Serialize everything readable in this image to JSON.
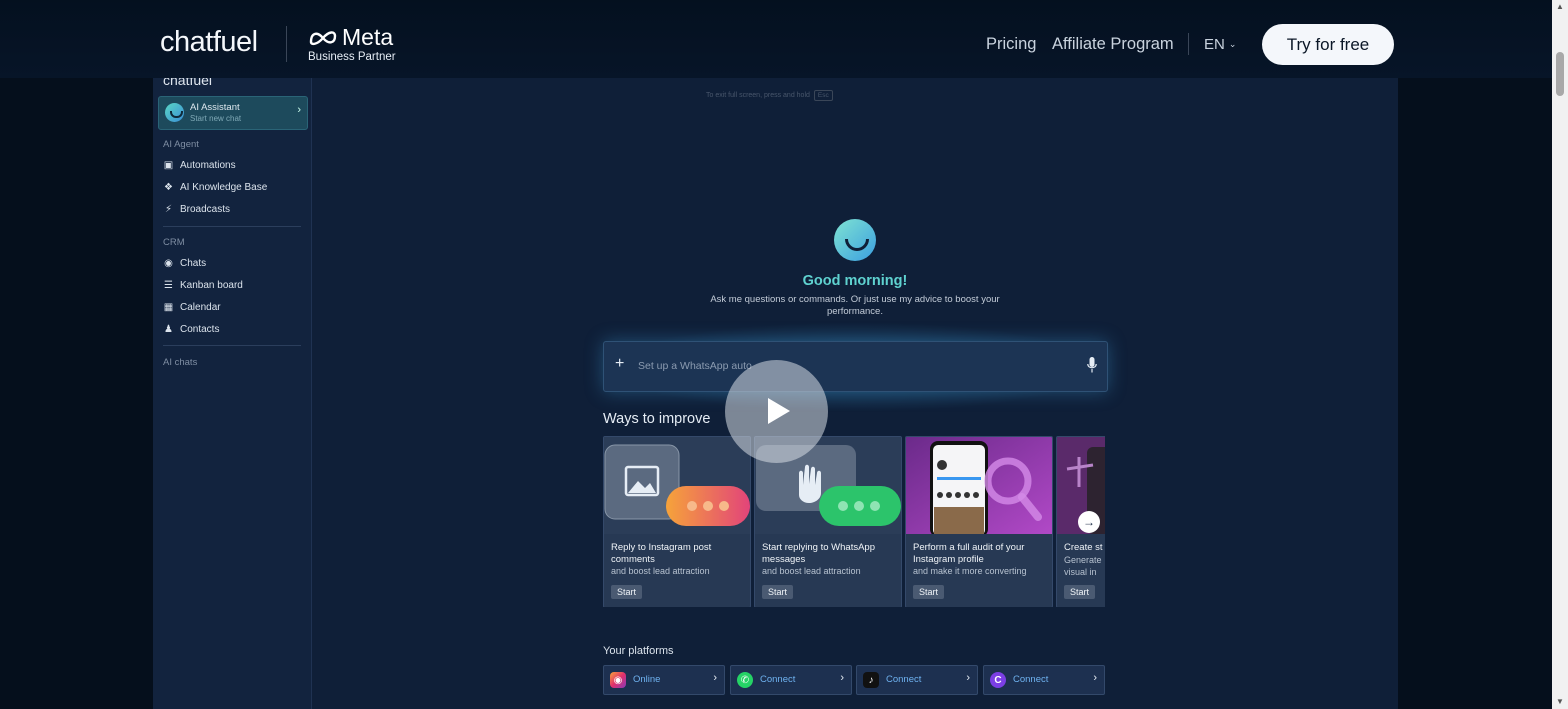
{
  "nav": {
    "brand": "chatfuel",
    "partner_word": "Meta",
    "partner_sub": "Business Partner",
    "links": [
      "Pricing",
      "Affiliate Program"
    ],
    "lang": "EN",
    "cta": "Try for free"
  },
  "sidebar": {
    "brand": "chatfuel",
    "assistant": {
      "title": "AI Assistant",
      "sub": "Start new chat"
    },
    "section_agent": "AI Agent",
    "agent_items": [
      "Automations",
      "AI Knowledge Base",
      "Broadcasts"
    ],
    "section_crm": "CRM",
    "crm_items": [
      "Chats",
      "Kanban board",
      "Calendar",
      "Contacts"
    ],
    "section_chats": "AI chats"
  },
  "main": {
    "esc_hint": "To exit full screen, press and hold",
    "esc_key": "Esc",
    "greeting": "Good morning!",
    "greeting_sub": "Ask me questions or commands. Or just use my advice to boost your performance.",
    "input_placeholder": "Set up a WhatsApp auto",
    "ways_title": "Ways to improve",
    "cards": [
      {
        "title": "Reply to Instagram post comments",
        "sub": "and boost lead attraction",
        "btn": "Start"
      },
      {
        "title": "Start replying to WhatsApp messages",
        "sub": "and boost lead attraction",
        "btn": "Start"
      },
      {
        "title": "Perform a full audit of your Instagram profile",
        "sub": "and make it more converting",
        "btn": "Start"
      },
      {
        "title": "Create st",
        "sub": "Generate",
        "sub2": "visual in",
        "btn": "Start"
      }
    ],
    "platforms_title": "Your platforms",
    "platforms": [
      {
        "label": "Online",
        "color": "#e1306c"
      },
      {
        "label": "Connect",
        "color": "#25d366"
      },
      {
        "label": "Connect",
        "color": "#111111"
      },
      {
        "label": "Connect",
        "color": "#7b3fe4"
      }
    ]
  },
  "colors": {
    "accent": "#5fd2d0",
    "bg": "#0f1f38",
    "link": "#6fb2f0"
  }
}
